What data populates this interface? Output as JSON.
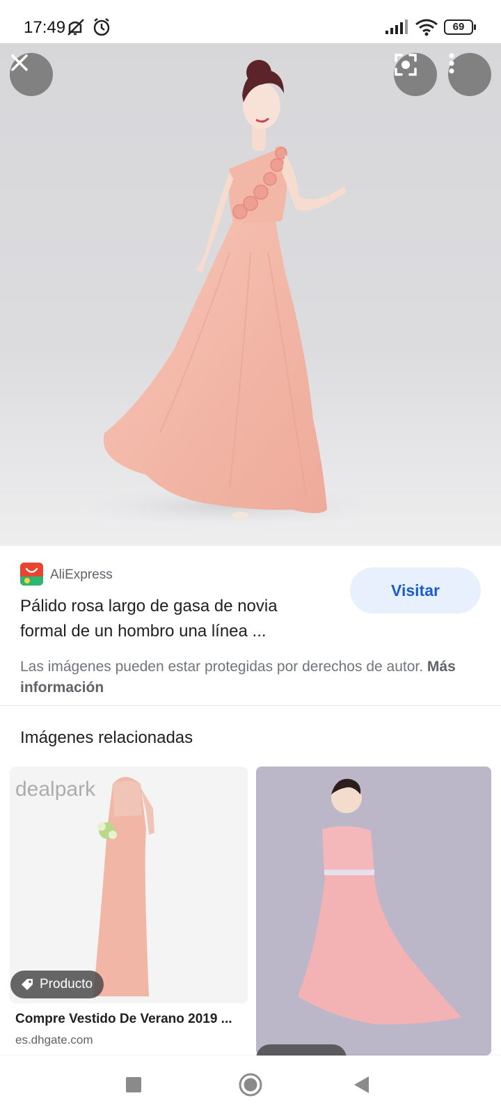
{
  "status_bar": {
    "time": "17:49",
    "battery": "69",
    "icons": [
      "mute-icon",
      "alarm-icon",
      "signal-icon",
      "wifi-icon",
      "battery-icon"
    ]
  },
  "viewer": {
    "buttons": [
      "close-icon",
      "lens-icon",
      "more-vert-icon"
    ]
  },
  "result": {
    "source_name": "AliExpress",
    "title": "Pálido rosa largo de gasa de novia formal de un hombro una línea ...",
    "visit_label": "Visitar",
    "copyright_text": "Las imágenes pueden estar protegidas por derechos de autor.",
    "copyright_link": "Más información"
  },
  "related": {
    "heading": "Imágenes relacionadas",
    "items": [
      {
        "badge": "Producto",
        "title": "Compre Vestido De Verano 2019 ...",
        "domain": "es.dhgate.com",
        "watermark": "dealpark"
      },
      {
        "badge": "",
        "title": "",
        "domain": ""
      }
    ]
  },
  "nav_bar": {
    "buttons": [
      "recents-icon",
      "home-icon",
      "back-icon"
    ]
  },
  "colors": {
    "dress_pink": "#f4bcae",
    "visit_bg": "#e8f0fe",
    "visit_text": "#1a5fc9",
    "aliexpress_red": "#e8442f"
  }
}
